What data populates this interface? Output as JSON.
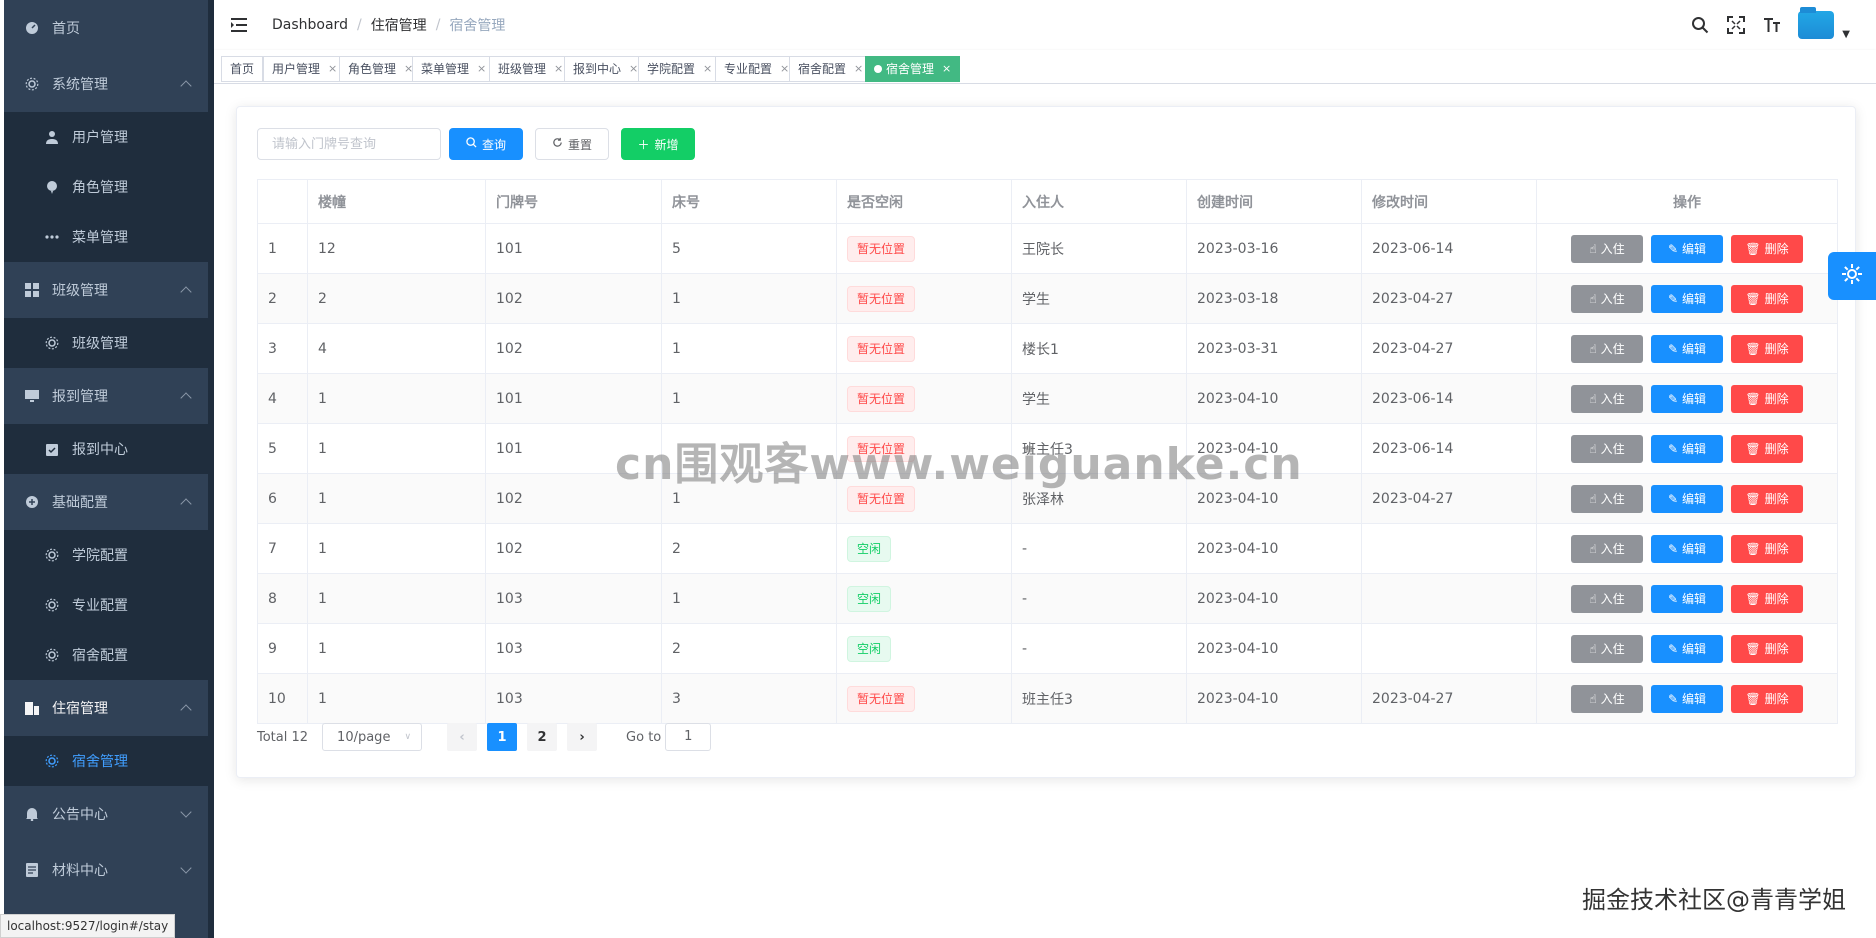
{
  "sidebar": {
    "items": [
      {
        "label": "首页",
        "icon": "dashboard-icon"
      },
      {
        "label": "系统管理",
        "icon": "gear-icon",
        "expanded": true,
        "children": [
          {
            "label": "用户管理",
            "icon": "user-icon"
          },
          {
            "label": "角色管理",
            "icon": "peoples-icon"
          },
          {
            "label": "菜单管理",
            "icon": "more-dots-icon"
          }
        ]
      },
      {
        "label": "班级管理",
        "icon": "grid-icon",
        "expanded": true,
        "children": [
          {
            "label": "班级管理",
            "icon": "gear-icon"
          }
        ]
      },
      {
        "label": "报到管理",
        "icon": "monitor-icon",
        "expanded": true,
        "children": [
          {
            "label": "报到中心",
            "icon": "clipboard-icon"
          }
        ]
      },
      {
        "label": "基础配置",
        "icon": "sync-icon",
        "expanded": true,
        "children": [
          {
            "label": "学院配置",
            "icon": "gear-icon"
          },
          {
            "label": "专业配置",
            "icon": "gear-icon"
          },
          {
            "label": "宿舍配置",
            "icon": "gear-icon"
          }
        ]
      },
      {
        "label": "住宿管理",
        "icon": "building-icon",
        "expanded": true,
        "children": [
          {
            "label": "宿舍管理",
            "icon": "gear-icon",
            "active": true
          }
        ]
      },
      {
        "label": "公告中心",
        "icon": "bell-icon",
        "expanded": false
      },
      {
        "label": "材料中心",
        "icon": "document-icon",
        "expanded": false
      }
    ]
  },
  "breadcrumb": [
    "Dashboard",
    "住宿管理",
    "宿舍管理"
  ],
  "header_icons": [
    "search-icon",
    "fullscreen-icon",
    "font-size-icon"
  ],
  "tags": [
    {
      "label": "首页",
      "closable": false
    },
    {
      "label": "用户管理",
      "closable": true
    },
    {
      "label": "角色管理",
      "closable": true
    },
    {
      "label": "菜单管理",
      "closable": true
    },
    {
      "label": "班级管理",
      "closable": true
    },
    {
      "label": "报到中心",
      "closable": true
    },
    {
      "label": "学院配置",
      "closable": true
    },
    {
      "label": "专业配置",
      "closable": true
    },
    {
      "label": "宿舍配置",
      "closable": true
    },
    {
      "label": "宿舍管理",
      "closable": true,
      "active": true
    }
  ],
  "toolbar": {
    "search_placeholder": "请输入门牌号查询",
    "query_label": "查询",
    "reset_label": "重置",
    "add_label": "新增"
  },
  "table": {
    "columns": [
      "",
      "楼幢",
      "门牌号",
      "床号",
      "是否空闲",
      "入住人",
      "创建时间",
      "修改时间",
      "操作"
    ],
    "rows": [
      {
        "index": "1",
        "building": "12",
        "door": "101",
        "bed": "5",
        "status": "暂无位置",
        "free": false,
        "occupant": "王院长",
        "created": "2023-03-16",
        "modified": "2023-06-14"
      },
      {
        "index": "2",
        "building": "2",
        "door": "102",
        "bed": "1",
        "status": "暂无位置",
        "free": false,
        "occupant": "学生",
        "created": "2023-03-18",
        "modified": "2023-04-27"
      },
      {
        "index": "3",
        "building": "4",
        "door": "102",
        "bed": "1",
        "status": "暂无位置",
        "free": false,
        "occupant": "楼长1",
        "created": "2023-03-31",
        "modified": "2023-04-27"
      },
      {
        "index": "4",
        "building": "1",
        "door": "101",
        "bed": "1",
        "status": "暂无位置",
        "free": false,
        "occupant": "学生",
        "created": "2023-04-10",
        "modified": "2023-06-14"
      },
      {
        "index": "5",
        "building": "1",
        "door": "101",
        "bed": "",
        "status": "暂无位置",
        "free": false,
        "occupant": "班主任3",
        "created": "2023-04-10",
        "modified": "2023-06-14"
      },
      {
        "index": "6",
        "building": "1",
        "door": "102",
        "bed": "1",
        "status": "暂无位置",
        "free": false,
        "occupant": "张泽林",
        "created": "2023-04-10",
        "modified": "2023-04-27"
      },
      {
        "index": "7",
        "building": "1",
        "door": "102",
        "bed": "2",
        "status": "空闲",
        "free": true,
        "occupant": "-",
        "created": "2023-04-10",
        "modified": ""
      },
      {
        "index": "8",
        "building": "1",
        "door": "103",
        "bed": "1",
        "status": "空闲",
        "free": true,
        "occupant": "-",
        "created": "2023-04-10",
        "modified": ""
      },
      {
        "index": "9",
        "building": "1",
        "door": "103",
        "bed": "2",
        "status": "空闲",
        "free": true,
        "occupant": "-",
        "created": "2023-04-10",
        "modified": ""
      },
      {
        "index": "10",
        "building": "1",
        "door": "103",
        "bed": "3",
        "status": "暂无位置",
        "free": false,
        "occupant": "班主任3",
        "created": "2023-04-10",
        "modified": "2023-04-27"
      }
    ],
    "actions": {
      "checkin": "入住",
      "edit": "编辑",
      "delete": "删除"
    }
  },
  "pagination": {
    "total_text": "Total 12",
    "page_size": "10/page",
    "pages": [
      "1",
      "2"
    ],
    "current": "1",
    "goto_label": "Go to",
    "goto_value": "1"
  },
  "watermarks": {
    "center": "cn围观客www.weiguanke.cn",
    "bottom": "掘金技术社区@青青学姐"
  },
  "status_url": "localhost:9527/login#/stay",
  "colors": {
    "sidebar_bg": "#304156",
    "submenu_bg": "#1f2d3d",
    "primary": "#1890ff",
    "success": "#13ce66",
    "danger": "#ff4949",
    "active_tag": "#42b983",
    "active_menu_text": "#409eff"
  }
}
